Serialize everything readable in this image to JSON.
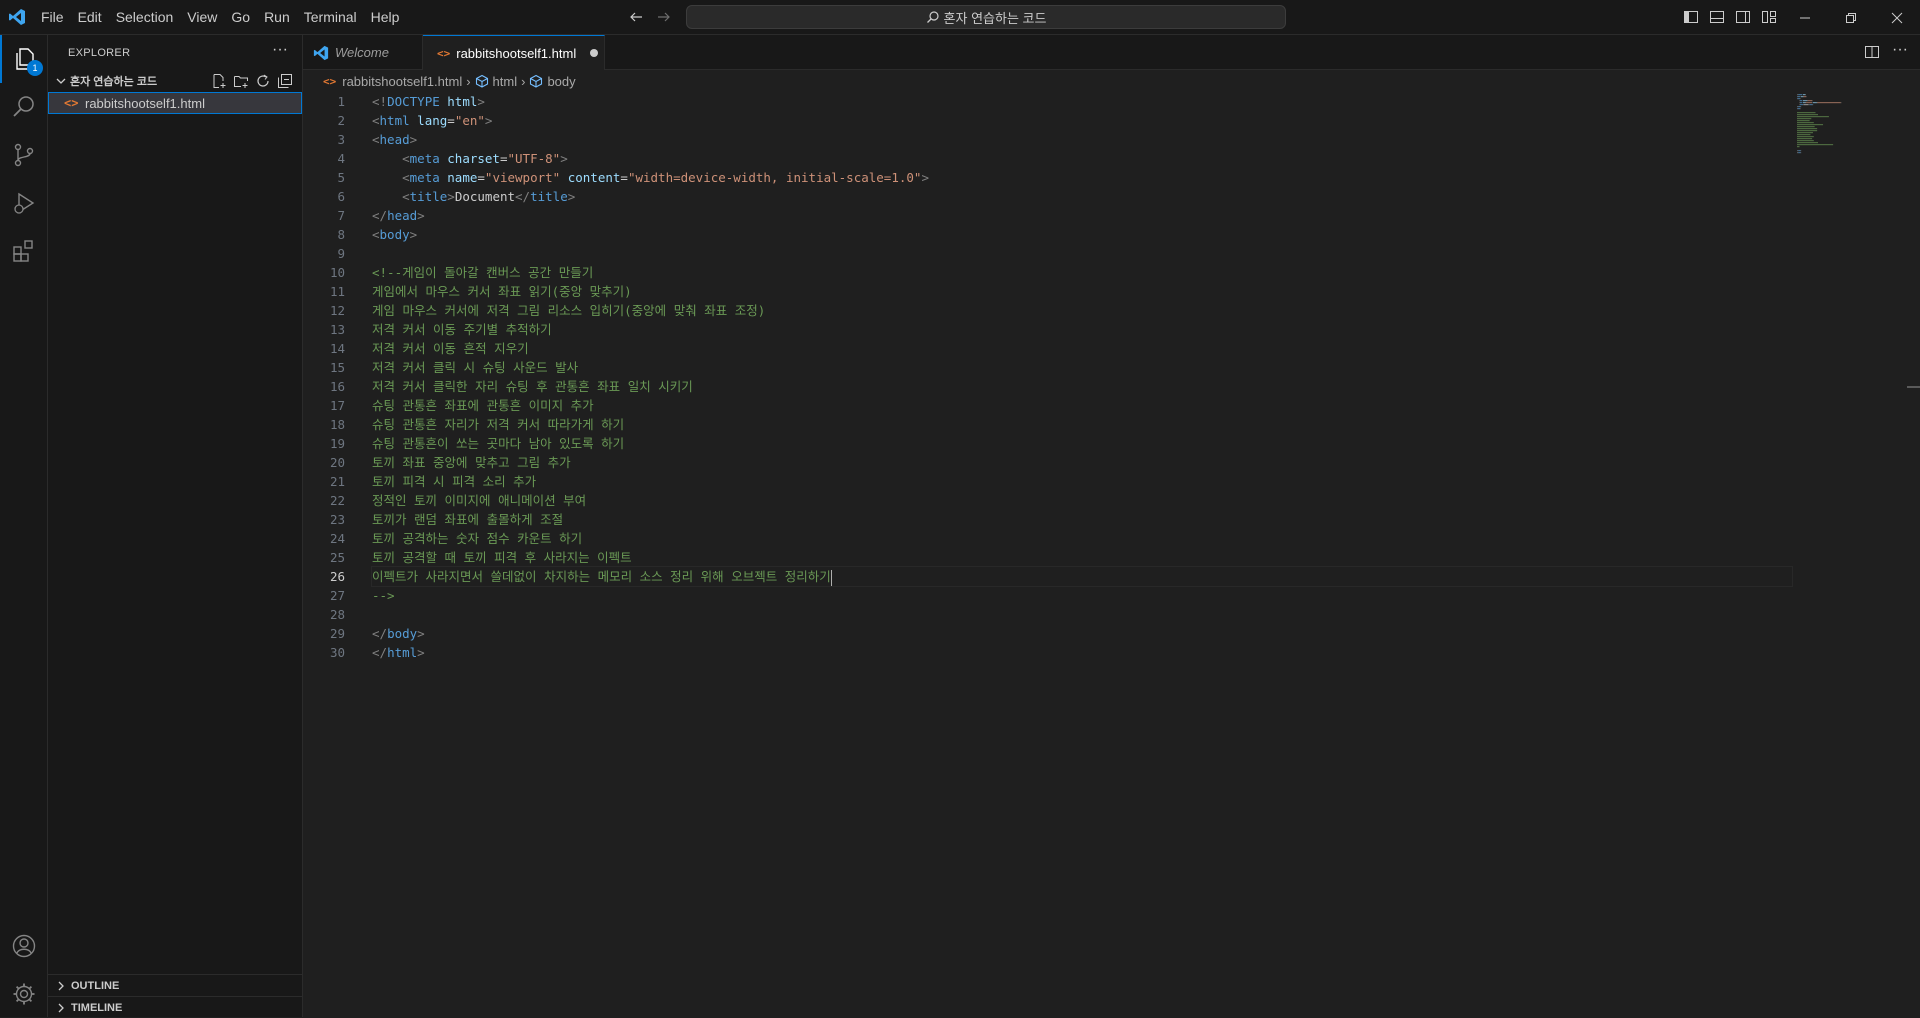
{
  "menu": [
    "File",
    "Edit",
    "Selection",
    "View",
    "Go",
    "Run",
    "Terminal",
    "Help"
  ],
  "command_center": {
    "label": "혼자 연습하는 코드"
  },
  "activity_bar": {
    "explorer_badge": "1"
  },
  "sidebar": {
    "title": "EXPLORER",
    "more": "···",
    "folder": "혼자 연습하는 코드",
    "files": [
      {
        "name": "rabbitshootself1.html",
        "icon": "html-file-icon"
      }
    ],
    "sections": [
      "OUTLINE",
      "TIMELINE"
    ]
  },
  "tabs": [
    {
      "label": "Welcome",
      "icon": "vscode-logo-icon"
    },
    {
      "label": "rabbitshootself1.html",
      "icon": "html-file-icon",
      "dirty": true
    }
  ],
  "breadcrumb": [
    "rabbitshootself1.html",
    "html",
    "body"
  ],
  "editor": {
    "current_line": 26,
    "lines": [
      [
        [
          "d",
          "<!"
        ],
        [
          "t",
          "DOCTYPE"
        ],
        [
          "x",
          " "
        ],
        [
          "a",
          "html"
        ],
        [
          "d",
          ">"
        ]
      ],
      [
        [
          "d",
          "<"
        ],
        [
          "t",
          "html"
        ],
        [
          "x",
          " "
        ],
        [
          "a",
          "lang"
        ],
        [
          "x",
          "="
        ],
        [
          "s",
          "\"en\""
        ],
        [
          "d",
          ">"
        ]
      ],
      [
        [
          "d",
          "<"
        ],
        [
          "t",
          "head"
        ],
        [
          "d",
          ">"
        ]
      ],
      [
        [
          "x",
          "    "
        ],
        [
          "d",
          "<"
        ],
        [
          "t",
          "meta"
        ],
        [
          "x",
          " "
        ],
        [
          "a",
          "charset"
        ],
        [
          "x",
          "="
        ],
        [
          "s",
          "\"UTF-8\""
        ],
        [
          "d",
          ">"
        ]
      ],
      [
        [
          "x",
          "    "
        ],
        [
          "d",
          "<"
        ],
        [
          "t",
          "meta"
        ],
        [
          "x",
          " "
        ],
        [
          "a",
          "name"
        ],
        [
          "x",
          "="
        ],
        [
          "s",
          "\"viewport\""
        ],
        [
          "x",
          " "
        ],
        [
          "a",
          "content"
        ],
        [
          "x",
          "="
        ],
        [
          "s",
          "\"width=device-width, initial-scale=1.0\""
        ],
        [
          "d",
          ">"
        ]
      ],
      [
        [
          "x",
          "    "
        ],
        [
          "d",
          "<"
        ],
        [
          "t",
          "title"
        ],
        [
          "d",
          ">"
        ],
        [
          "x",
          "Document"
        ],
        [
          "d",
          "</"
        ],
        [
          "t",
          "title"
        ],
        [
          "d",
          ">"
        ]
      ],
      [
        [
          "d",
          "</"
        ],
        [
          "t",
          "head"
        ],
        [
          "d",
          ">"
        ]
      ],
      [
        [
          "d",
          "<"
        ],
        [
          "t",
          "body"
        ],
        [
          "d",
          ">"
        ]
      ],
      [],
      [
        [
          "c",
          "<!--게임이 돌아갈 캔버스 공간 만들기"
        ]
      ],
      [
        [
          "c",
          "게임에서 마우스 커서 좌표 읽기(중앙 맞추기)"
        ]
      ],
      [
        [
          "c",
          "게임 마우스 커서에 저격 그림 리소스 입히기(중앙에 맞춰 좌표 조정)"
        ]
      ],
      [
        [
          "c",
          "저격 커서 이동 주기별 추적하기"
        ]
      ],
      [
        [
          "c",
          "저격 커서 이동 흔적 지우기"
        ]
      ],
      [
        [
          "c",
          "저격 커서 클릭 시 슈팅 사운드 발사"
        ]
      ],
      [
        [
          "c",
          "저격 커서 클릭한 자리 슈팅 후 관통흔 좌표 일치 시키기"
        ]
      ],
      [
        [
          "c",
          "슈팅 관통흔 좌표에 관통흔 이미지 추가"
        ]
      ],
      [
        [
          "c",
          "슈팅 관통흔 자리가 저격 커서 따라가게 하기"
        ]
      ],
      [
        [
          "c",
          "슈팅 관통흔이 쏘는 곳마다 남아 있도록 하기"
        ]
      ],
      [
        [
          "c",
          "토끼 좌표 중앙에 맞추고 그림 추가"
        ]
      ],
      [
        [
          "c",
          "토끼 피격 시 피격 소리 추가"
        ]
      ],
      [
        [
          "c",
          "정적인 토끼 이미지에 애니메이션 부여"
        ]
      ],
      [
        [
          "c",
          "토끼가 랜덤 좌표에 출몰하게 조절"
        ]
      ],
      [
        [
          "c",
          "토끼 공격하는 숫자 점수 카운트 하기"
        ]
      ],
      [
        [
          "c",
          "토끼 공격할 때 토끼 피격 후 사라지는 이펙트"
        ]
      ],
      [
        [
          "c",
          "이펙트가 사라지면서 쓸데없이 차지하는 메모리 소스 정리 위해 오브젝트 정리하기"
        ]
      ],
      [
        [
          "c",
          "-->"
        ]
      ],
      [],
      [
        [
          "d",
          "</"
        ],
        [
          "t",
          "body"
        ],
        [
          "d",
          ">"
        ]
      ],
      [
        [
          "d",
          "</"
        ],
        [
          "t",
          "html"
        ],
        [
          "d",
          ">"
        ]
      ]
    ]
  },
  "colors": {
    "accent": "#0078d4",
    "tag": "#569cd6",
    "attribute": "#9cdcfe",
    "string": "#ce9178",
    "comment": "#6a9955",
    "html_icon": "#e37933"
  }
}
